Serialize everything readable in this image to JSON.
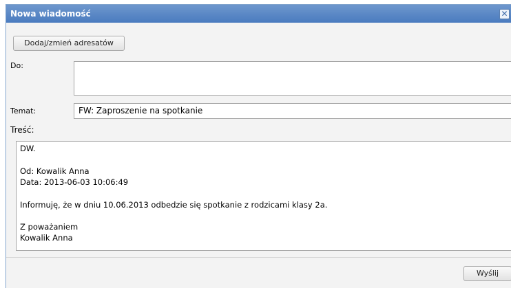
{
  "dialog": {
    "title": "Nowa wiadomość",
    "close_icon": "close-icon"
  },
  "recipients_button": "Dodaj/zmień adresatów",
  "to": {
    "label": "Do:",
    "value": ""
  },
  "subject": {
    "label": "Temat:",
    "value": "FW: Zaproszenie na spotkanie"
  },
  "body": {
    "label": "Treść:",
    "lines": [
      "DW.",
      "Od: Kowalik Anna",
      "Data: 2013-06-03 10:06:49",
      "Informuję, że w dniu 10.06.2013 odbedzie się spotkanie z rodzicami klasy 2a.",
      "Z poważaniem",
      "Kowalik Anna"
    ]
  },
  "send_button": "Wyślij",
  "colors": {
    "titlebar": "#4a7bbf",
    "background": "#f3f3f3"
  }
}
